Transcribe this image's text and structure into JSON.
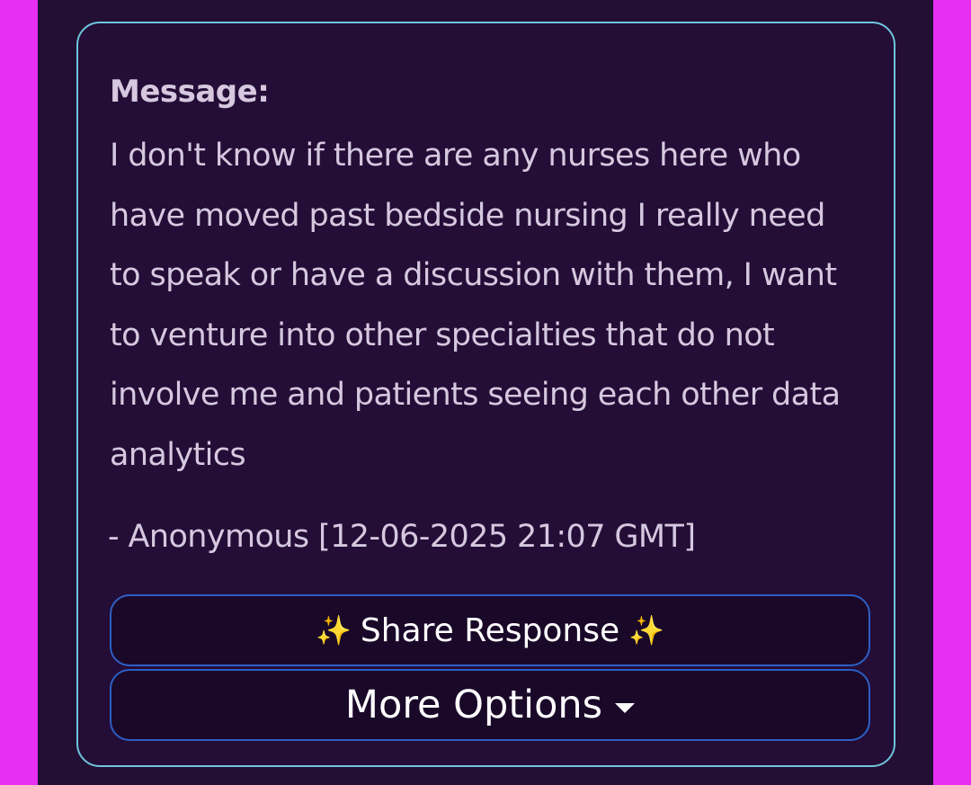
{
  "card": {
    "heading": "Message:",
    "body": "I don't know if there are any nurses here who have moved past bedside nursing I really need to speak or have a discussion with them, I want to venture into other specialties that do not involve me and patients seeing each other data analytics",
    "author_line": "- Anonymous [12-06-2025 21:07 GMT]"
  },
  "actions": {
    "share_label": "Share Response",
    "more_label": "More Options"
  },
  "icons": {
    "sparkle": "sparkles-icon",
    "caret": "caret-down-icon"
  },
  "colors": {
    "background_accent": "#e82ef0",
    "panel": "#230f33",
    "card_border": "#6fc4dc",
    "button_border": "#2d5fc4",
    "text": "#d5c8df"
  }
}
